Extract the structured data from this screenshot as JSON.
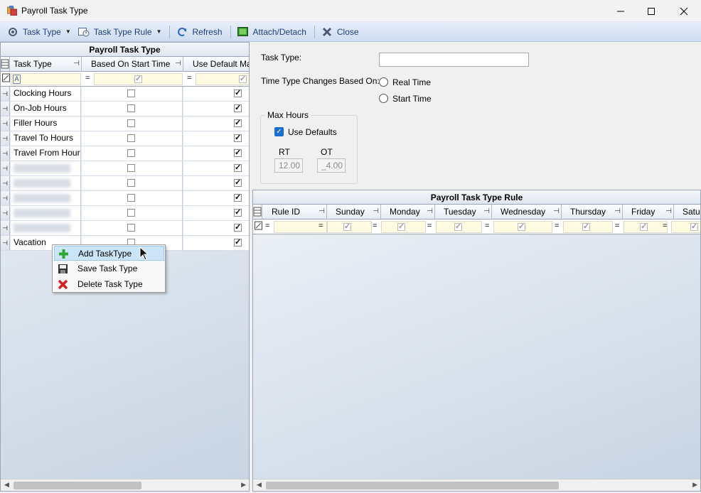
{
  "window": {
    "title": "Payroll Task Type"
  },
  "toolbar": {
    "task_type": "Task Type",
    "task_type_rule": "Task Type Rule",
    "refresh": "Refresh",
    "attach_detach": "Attach/Detach",
    "close": "Close"
  },
  "left_grid": {
    "caption": "Payroll Task Type",
    "columns": [
      "Task Type",
      "Based On Start Time",
      "Use Default Max"
    ],
    "rows": [
      {
        "name": "Clocking Hours",
        "based_on_start": false,
        "use_default_max": true
      },
      {
        "name": "On-Job Hours",
        "based_on_start": false,
        "use_default_max": true
      },
      {
        "name": "Filler Hours",
        "based_on_start": false,
        "use_default_max": true
      },
      {
        "name": "Travel To Hours",
        "based_on_start": false,
        "use_default_max": true
      },
      {
        "name": "Travel From Hour",
        "based_on_start": false,
        "use_default_max": true
      },
      {
        "name": "",
        "based_on_start": false,
        "use_default_max": true
      },
      {
        "name": "",
        "based_on_start": false,
        "use_default_max": true
      },
      {
        "name": "",
        "based_on_start": false,
        "use_default_max": true
      },
      {
        "name": "",
        "based_on_start": false,
        "use_default_max": true
      },
      {
        "name": "",
        "based_on_start": false,
        "use_default_max": true
      },
      {
        "name": "Vacation",
        "based_on_start": false,
        "use_default_max": true
      }
    ]
  },
  "context_menu": {
    "add": "Add TaskType",
    "save": "Save Task Type",
    "delete": "Delete Task Type"
  },
  "form": {
    "task_type_label": "Task Type:",
    "task_type_value": "",
    "time_type_label": "Time Type Changes Based On:",
    "real_time": "Real Time",
    "start_time": "Start Time",
    "max_hours_title": "Max Hours",
    "use_defaults": "Use Defaults",
    "rt_label": "RT",
    "ot_label": "OT",
    "rt_value": "12.00",
    "ot_value": "_4.00"
  },
  "right_grid": {
    "caption": "Payroll Task Type Rule",
    "columns": [
      "Rule ID",
      "Sunday",
      "Monday",
      "Tuesday",
      "Wednesday",
      "Thursday",
      "Friday",
      "Saturday"
    ]
  },
  "colors": {
    "toolbar_text": "#1e3f78",
    "highlight": "#cce4f7"
  }
}
